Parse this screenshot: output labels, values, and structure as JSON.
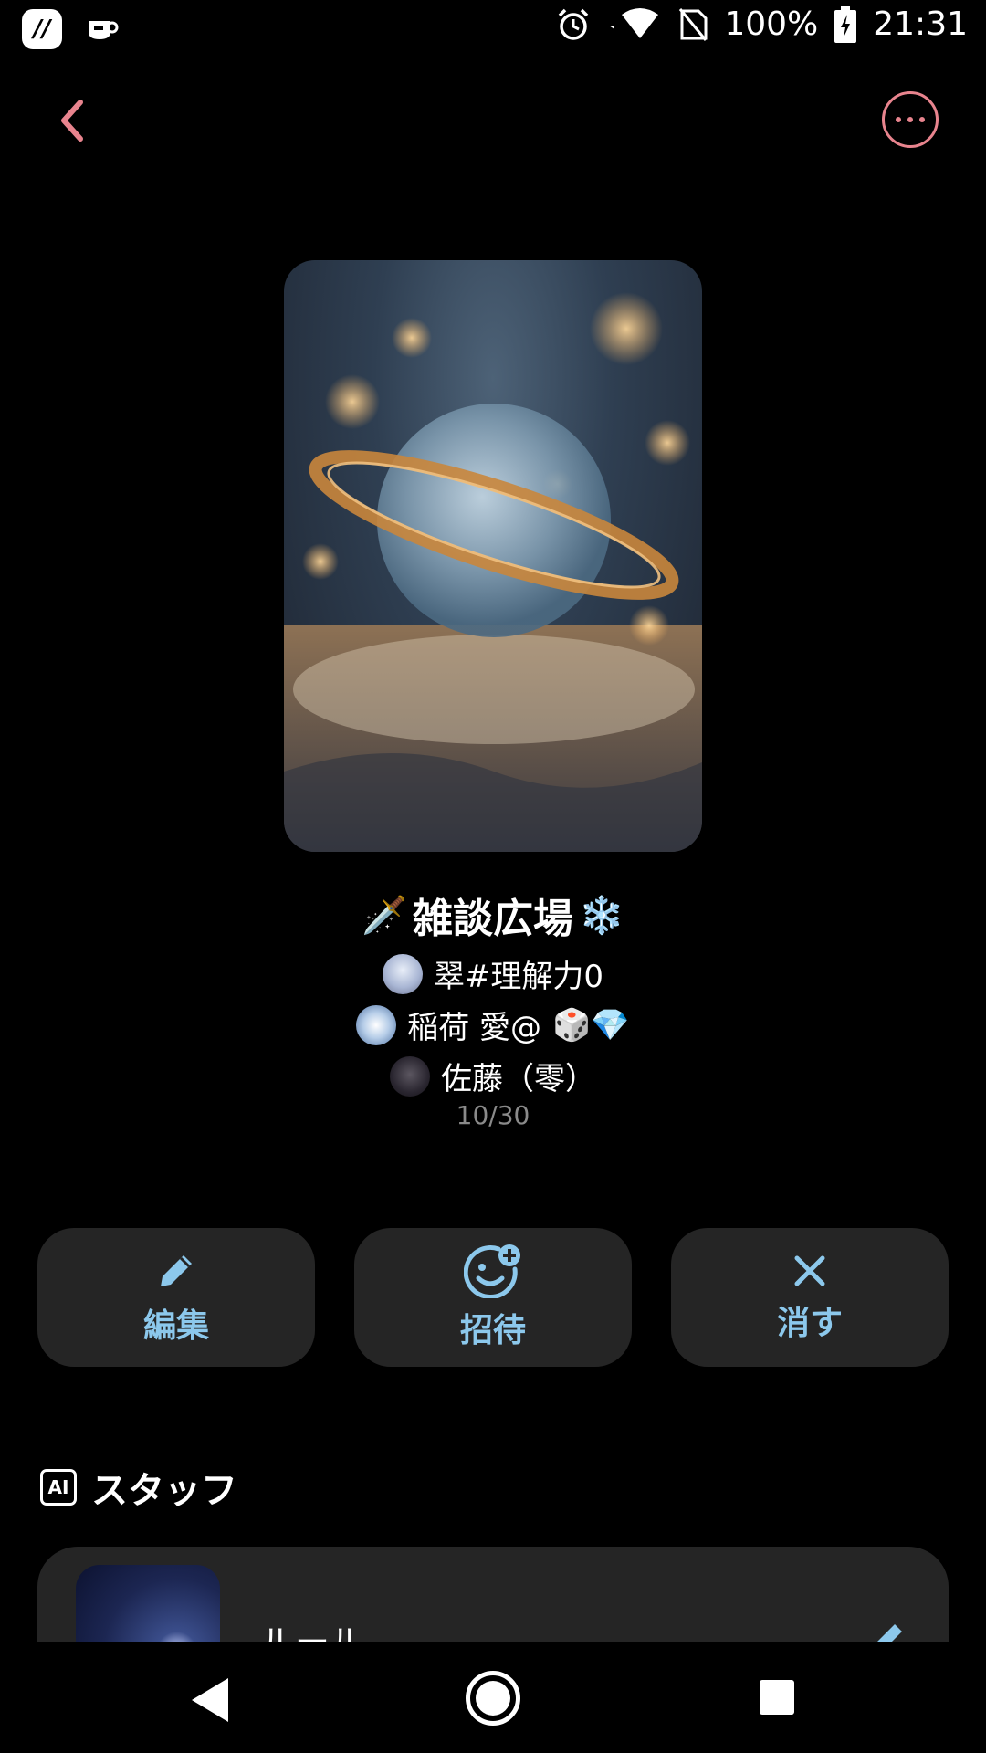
{
  "status_bar": {
    "battery": "100%",
    "time": "21:31",
    "icons": [
      "app-icon",
      "cup-icon",
      "alarm-icon",
      "wifi-icon",
      "no-sim-icon",
      "battery-charging-icon"
    ]
  },
  "top_bar": {
    "back_icon": "chevron-left-icon",
    "more_icon": "more-horizontal-icon",
    "accent_color": "#e8848e"
  },
  "room": {
    "title_prefix_emoji": "🗡️",
    "title": "雑談広場",
    "title_suffix_emoji": "❄️",
    "members": [
      {
        "name": "翠#理解力0",
        "badges": ""
      },
      {
        "name": "稲荷 愛@",
        "badges": "🎲💎"
      },
      {
        "name": "佐藤（零）",
        "badges": ""
      }
    ],
    "count": "10/30"
  },
  "actions": {
    "edit_label": "編集",
    "invite_label": "招待",
    "delete_label": "消す",
    "accent_color": "#8cc8ec"
  },
  "staff": {
    "badge": "AI",
    "title": "スタッフ",
    "items": [
      {
        "name": "ルール"
      }
    ]
  }
}
